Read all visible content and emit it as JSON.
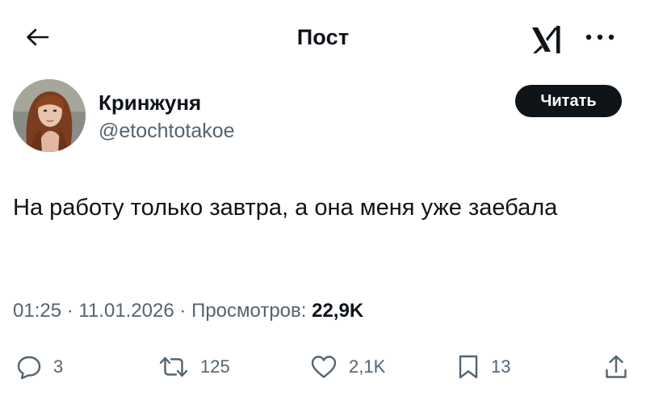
{
  "header": {
    "title": "Пост",
    "back_icon": "arrow-left-icon",
    "logo_icon": "x-logo-icon",
    "more_icon": "more-horizontal-icon"
  },
  "author": {
    "name": "Кринжуня",
    "handle": "@etochtotakoe",
    "follow_label": "Читать"
  },
  "tweet": {
    "text": "На работу только завтра, а она меня уже заебала",
    "time": "01:25",
    "date": "11.01.2026",
    "views_label": "Просмотров:",
    "views": "22,9K"
  },
  "actions": {
    "replies": "3",
    "reposts": "125",
    "likes": "2,1K",
    "bookmarks": "13"
  },
  "colors": {
    "text": "#0f1419",
    "secondary": "#536471",
    "button_bg": "#0f1419",
    "background": "#ffffff"
  }
}
